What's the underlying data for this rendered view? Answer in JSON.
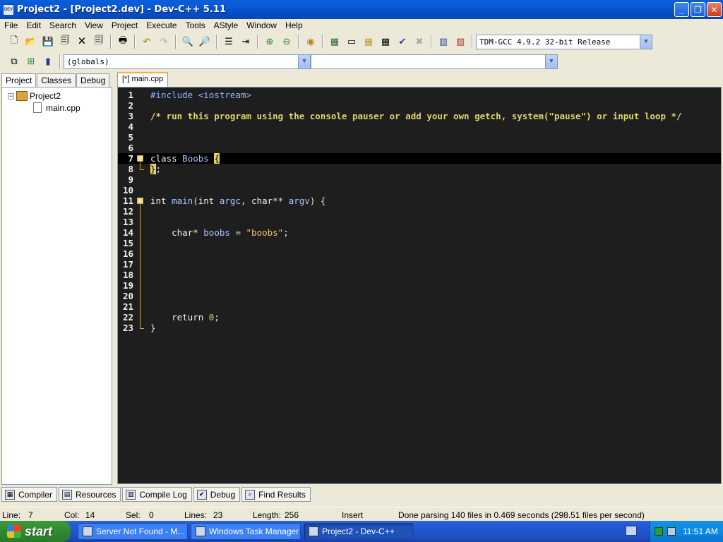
{
  "window": {
    "title": "Project2 - [Project2.dev] - Dev-C++ 5.11",
    "icon_label": "DEV"
  },
  "menu": [
    "File",
    "Edit",
    "Search",
    "View",
    "Project",
    "Execute",
    "Tools",
    "AStyle",
    "Window",
    "Help"
  ],
  "toolbar": {
    "compiler_select": "TDM-GCC 4.9.2 32-bit Release",
    "scope_select": "(globals)",
    "member_select": ""
  },
  "left_panel": {
    "tabs": [
      "Project",
      "Classes",
      "Debug"
    ],
    "active_tab": "Project",
    "tree": {
      "project": "Project2",
      "files": [
        "main.cpp"
      ],
      "expander": "−"
    }
  },
  "editor": {
    "tab_label": "[*] main.cpp",
    "lines": [
      {
        "n": "1",
        "code": "#include <iostream>"
      },
      {
        "n": "2",
        "code": ""
      },
      {
        "n": "3",
        "code": "/* run this program using the console pauser or add your own getch, system(\"pause\") or input loop */"
      },
      {
        "n": "4",
        "code": ""
      },
      {
        "n": "5",
        "code": ""
      },
      {
        "n": "6",
        "code": ""
      },
      {
        "n": "7",
        "code": "class Boobs {"
      },
      {
        "n": "8",
        "code": "};"
      },
      {
        "n": "9",
        "code": ""
      },
      {
        "n": "10",
        "code": ""
      },
      {
        "n": "11",
        "code": "int main(int argc, char** argv) {"
      },
      {
        "n": "12",
        "code": ""
      },
      {
        "n": "13",
        "code": ""
      },
      {
        "n": "14",
        "code": "    char* boobs = \"boobs\";"
      },
      {
        "n": "15",
        "code": ""
      },
      {
        "n": "16",
        "code": ""
      },
      {
        "n": "17",
        "code": ""
      },
      {
        "n": "18",
        "code": ""
      },
      {
        "n": "19",
        "code": ""
      },
      {
        "n": "20",
        "code": ""
      },
      {
        "n": "21",
        "code": ""
      },
      {
        "n": "22",
        "code": "    return 0;"
      },
      {
        "n": "23",
        "code": "}"
      }
    ],
    "current_line": "7"
  },
  "bottom_tabs": [
    "Compiler",
    "Resources",
    "Compile Log",
    "Debug",
    "Find Results"
  ],
  "status": {
    "line_label": "Line:",
    "line_value": "7",
    "col_label": "Col:",
    "col_value": "14",
    "sel_label": "Sel:",
    "sel_value": "0",
    "lines_label": "Lines:",
    "lines_value": "23",
    "length_label": "Length:",
    "length_value": "256",
    "mode": "Insert",
    "message": "Done parsing 140 files in 0.469 seconds (298.51 files per second)"
  },
  "taskbar": {
    "start_label": "start",
    "tasks": [
      "Server Not Found - M...",
      "Windows Task Manager",
      "Project2 - Dev-C++"
    ],
    "active_task": "Project2 - Dev-C++",
    "clock": "11:51 AM"
  },
  "colors": {
    "editor_bg": "#1e1e1e",
    "comment": "#e2d36a",
    "preprocessor": "#8ab4ff",
    "string": "#f0c674",
    "titlebar": "#0a5fd8"
  }
}
